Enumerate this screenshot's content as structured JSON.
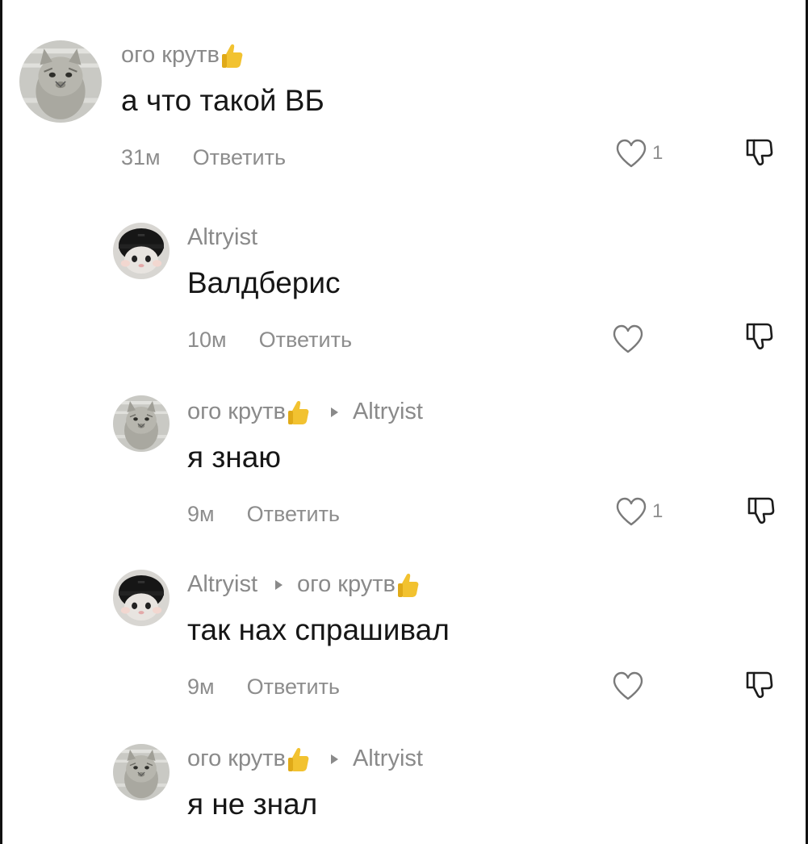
{
  "comments": [
    {
      "author": "ого крутв",
      "reply_to": "",
      "text": "а что такой ВБ",
      "time": "31м",
      "reply_label": "Ответить",
      "likes": "1",
      "avatar": "cat"
    },
    {
      "author": "Altryist",
      "reply_to": "",
      "text": "Валдберис",
      "time": "10м",
      "reply_label": "Ответить",
      "likes": "",
      "avatar": "helmet"
    },
    {
      "author": "ого крутв",
      "reply_to": "Altryist",
      "text": "я знаю",
      "time": "9м",
      "reply_label": "Ответить",
      "likes": "1",
      "avatar": "cat"
    },
    {
      "author": "Altryist",
      "reply_to": "ого крутв",
      "text": "так нах спрашивал",
      "time": "9м",
      "reply_label": "Ответить",
      "likes": "",
      "avatar": "helmet"
    },
    {
      "author": "ого крутв",
      "reply_to": "Altryist",
      "text": "я не знал",
      "time": "",
      "reply_label": "",
      "likes": "",
      "avatar": "cat"
    }
  ],
  "icons": {
    "author_badge": "thumbs-up-emoji",
    "like": "heart-icon",
    "dislike": "thumbs-down-icon",
    "reply_arrow": "triangle-right-icon"
  },
  "colors": {
    "meta": "#8a8a8a",
    "text": "#161616",
    "badge": "#f2c230"
  }
}
